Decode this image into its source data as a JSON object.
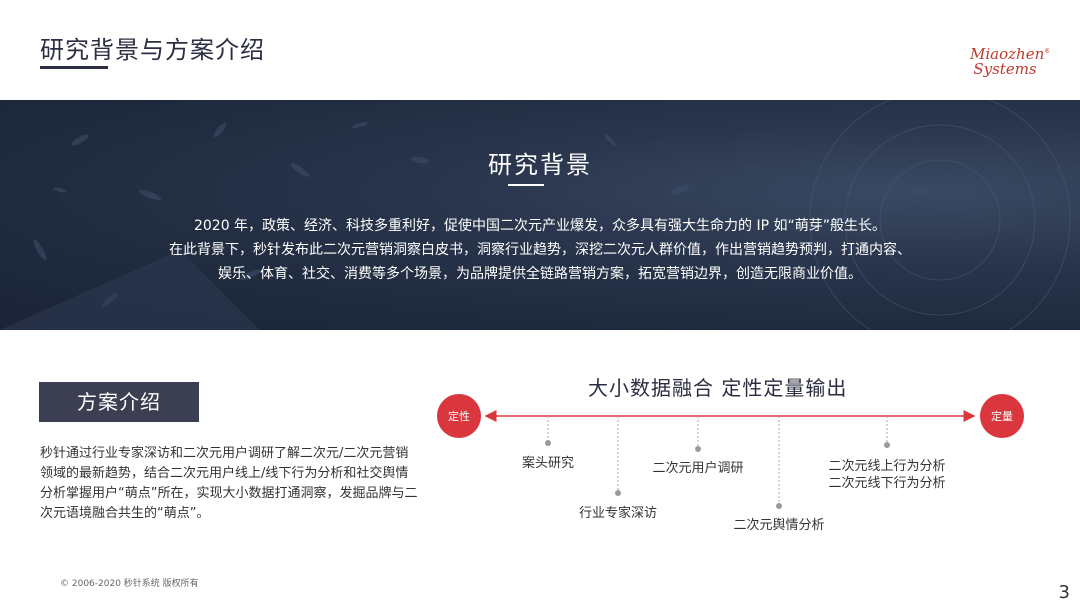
{
  "header": {
    "title": "研究背景与方案介绍",
    "logo_line1": "Miaozhen",
    "logo_line2": "Systems",
    "logo_mark": "®"
  },
  "banner": {
    "title": "研究背景",
    "lines": [
      "2020 年，政策、经济、科技多重利好，促使中国二次元产业爆发，众多具有强大生命力的 IP 如“萌芽”般生长。",
      "在此背景下，秒针发布此二次元营销洞察白皮书，洞察行业趋势，深挖二次元人群价值，作出营销趋势预判，打通内容、",
      "娱乐、体育、社交、消费等多个场景，为品牌提供全链路营销方案，拓宽营销边界，创造无限商业价值。"
    ]
  },
  "plan": {
    "label": "方案介绍",
    "text": "秒针通过行业专家深访和二次元用户调研了解二次元/二次元营销领域的最新趋势，结合二次元用户线上/线下行为分析和社交舆情分析掌握用户“萌点”所在，实现大小数据打通洞察，发掘品牌与二次元语境融合共生的“萌点”。"
  },
  "diagram": {
    "title": "大小数据融合  定性定量输出",
    "left_label": "定性",
    "right_label": "定量",
    "accent": "#d9363e",
    "items": [
      {
        "label": "案头研究"
      },
      {
        "label": "行业专家深访"
      },
      {
        "label": "二次元用户调研"
      },
      {
        "label": "二次元舆情分析"
      },
      {
        "label": "二次元线上行为分析",
        "label2": "二次元线下行为分析"
      }
    ]
  },
  "footer": {
    "copyright": "© 2006-2020 秒针系统 版权所有",
    "page": "3"
  }
}
